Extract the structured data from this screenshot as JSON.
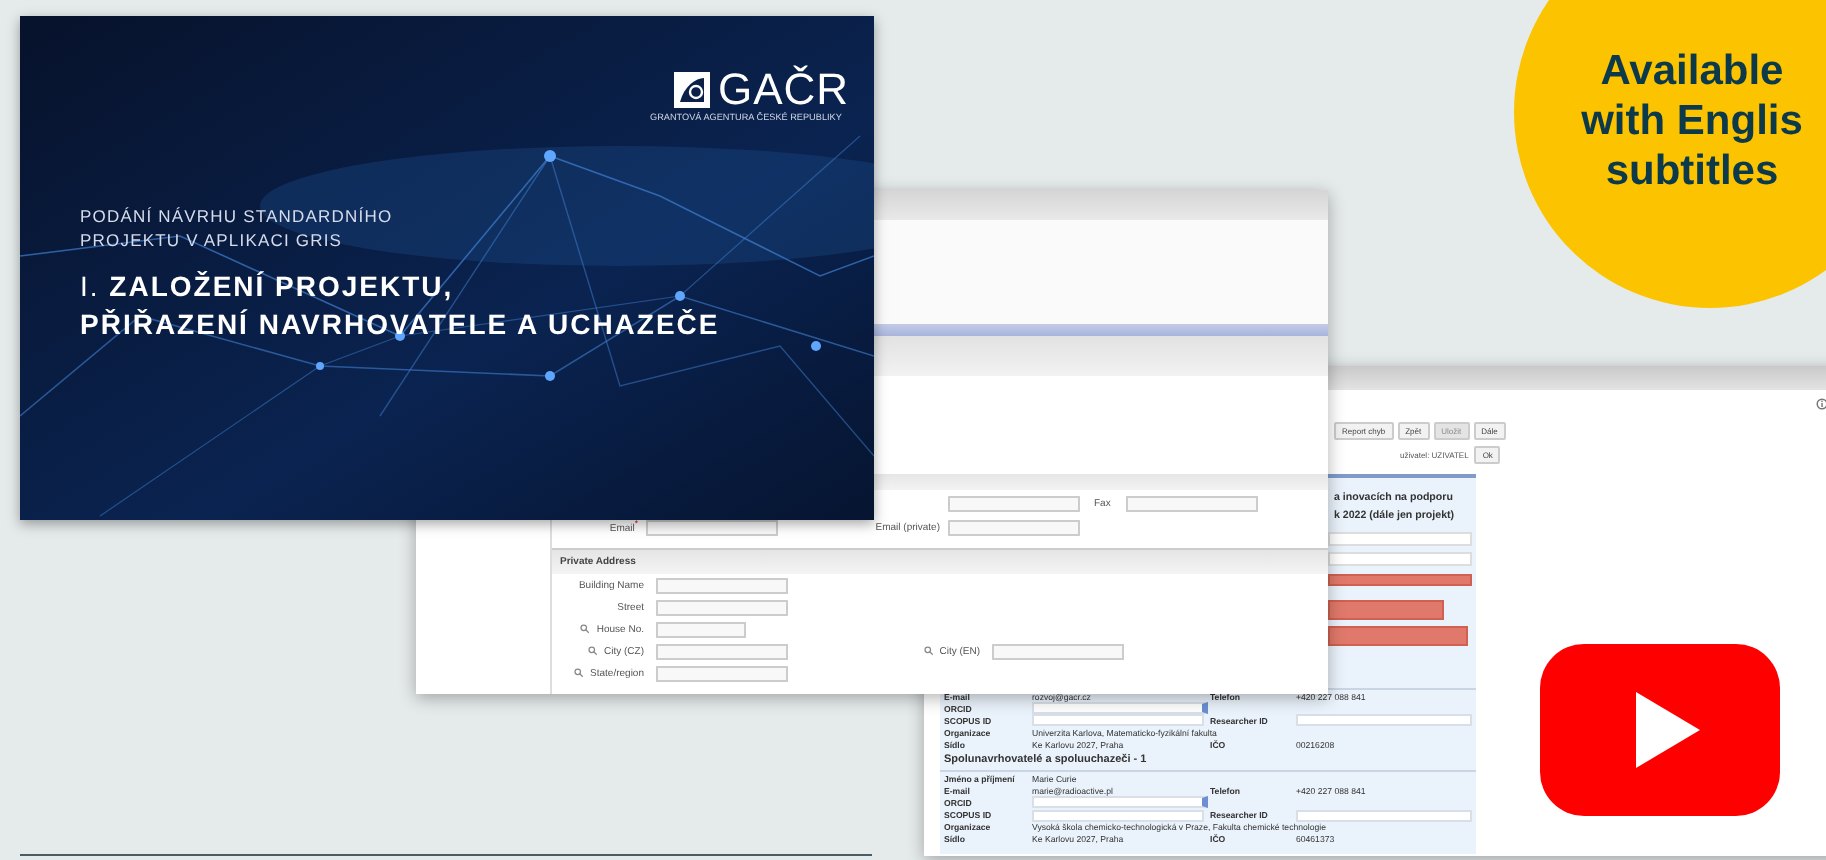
{
  "video_card": {
    "logo": {
      "text": "GAČR",
      "tagline": "GRANTOVÁ AGENTURA ČESKÉ REPUBLIKY"
    },
    "subtitle_lines": [
      "PODÁNÍ NÁVRHU STANDARDNÍHO",
      "PROJEKTU V APLIKACI GRIS"
    ],
    "title": {
      "number": "I.",
      "lines": [
        "ZALOŽENÍ PROJEKTU,",
        "PŘIŘAZENÍ NAVRHOVATELE A UCHAZEČE"
      ]
    }
  },
  "form_window": {
    "contact_rows": [
      {
        "kind": "fax",
        "label": "Fax"
      },
      {
        "kind": "pair",
        "label": "Email$^{*}$",
        "label_2": "Email (private)"
      }
    ],
    "section": "Private Address",
    "address_rows": [
      {
        "kind": "wide",
        "label": "Building Name",
        "lookup": false
      },
      {
        "kind": "wide",
        "label": "Street",
        "lookup": false
      },
      {
        "kind": "short",
        "label": "House No.",
        "lookup": true
      },
      {
        "kind": "pair",
        "label": "City (CZ)",
        "lookup": true,
        "label_2": "City (EN)"
      },
      {
        "kind": "wide",
        "label": "State/region",
        "lookup": true
      }
    ]
  },
  "app_window": {
    "buttons": [
      {
        "label": "Report chyb",
        "disabled": false
      },
      {
        "label": "Zpět",
        "disabled": false
      },
      {
        "label": "Uložit",
        "disabled": true
      },
      {
        "label": "Dále",
        "disabled": false
      }
    ],
    "user": "uživatel: UZIVATEL",
    "user_button": "Ok",
    "heading_lines": [
      "a inovacích na podporu",
      "k 2022 (dále jen projekt)"
    ],
    "rows": [
      {
        "kind": "text",
        "label": "E-mail",
        "value": "rozvoj@gacr.cz",
        "label_2": "Telefon",
        "value_2": "+420 227 088 841"
      },
      {
        "kind": "select",
        "label": "ORCID"
      },
      {
        "kind": "field",
        "label": "SCOPUS ID",
        "label_2": "Researcher ID"
      },
      {
        "kind": "text",
        "label": "Organizace",
        "value": "Univerzita Karlova, Matematicko-fyzikální fakulta"
      },
      {
        "kind": "text",
        "label": "Sídlo",
        "value": "Ke Karlovu 2027, Praha",
        "label_2": "IČO",
        "value_2": "00216208"
      },
      {
        "kind": "heading",
        "label": "Spolunavrhovatelé a spoluuchazeči - 1"
      },
      {
        "kind": "text",
        "label": "Jméno a příjmení",
        "value": "Marie Curie"
      },
      {
        "kind": "text",
        "label": "E-mail",
        "value": "marie@radioactive.pl",
        "label_2": "Telefon",
        "value_2": "+420 227 088 841"
      },
      {
        "kind": "select",
        "label": "ORCID"
      },
      {
        "kind": "field",
        "label": "SCOPUS ID",
        "label_2": "Researcher ID"
      },
      {
        "kind": "text",
        "label": "Organizace",
        "value": "Vysoká škola chemicko-technologická v Praze, Fakulta chemické technologie"
      },
      {
        "kind": "text",
        "label": "Sídlo",
        "value": "Ke Karlovu 2027, Praha",
        "label_2": "IČO",
        "value_2": "60461373"
      }
    ]
  },
  "badge": {
    "lines": [
      "Available",
      "with Englis",
      "subtitles"
    ]
  }
}
